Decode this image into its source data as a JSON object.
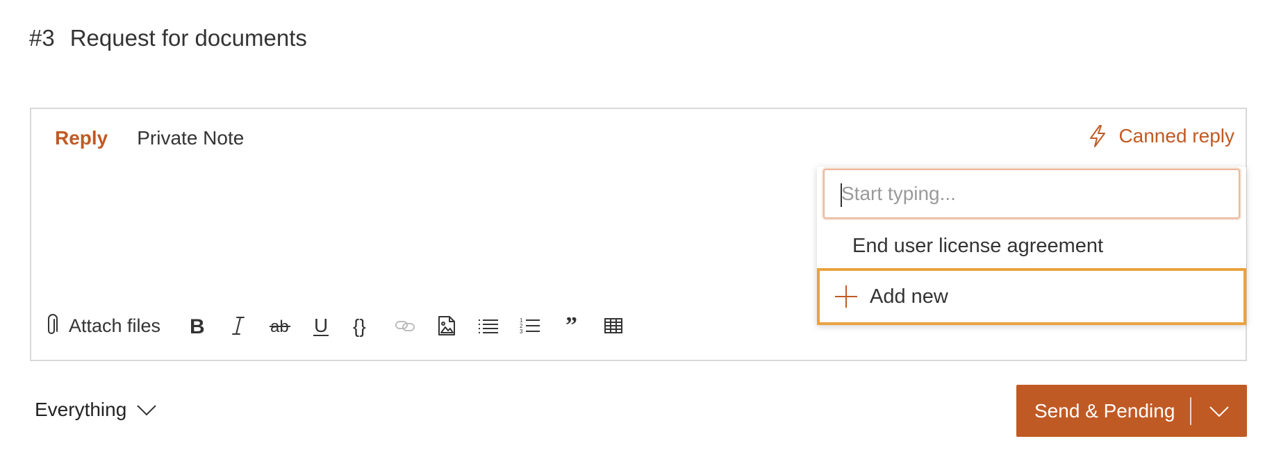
{
  "ticket": {
    "number": "#3",
    "title": "Request for documents"
  },
  "editor": {
    "tabs": [
      {
        "label": "Reply",
        "active": true
      },
      {
        "label": "Private Note",
        "active": false
      }
    ],
    "canned_reply_label": "Canned reply",
    "canned_dropdown": {
      "search_placeholder": "Start typing...",
      "search_value": "",
      "items": [
        "End user license agreement"
      ],
      "add_new_label": "Add new"
    },
    "toolbar": {
      "attach_label": "Attach files",
      "buttons": [
        "bold-icon",
        "italic-icon",
        "strikethrough-icon",
        "underline-icon",
        "code-icon",
        "link-icon",
        "image-icon",
        "bullet-list-icon",
        "numbered-list-icon",
        "quote-icon",
        "table-icon"
      ]
    }
  },
  "footer": {
    "filter_label": "Everything",
    "send_label": "Send & Pending"
  },
  "colors": {
    "accent": "#c05a24",
    "highlight": "#e9a241",
    "border": "#d8d8d8"
  }
}
